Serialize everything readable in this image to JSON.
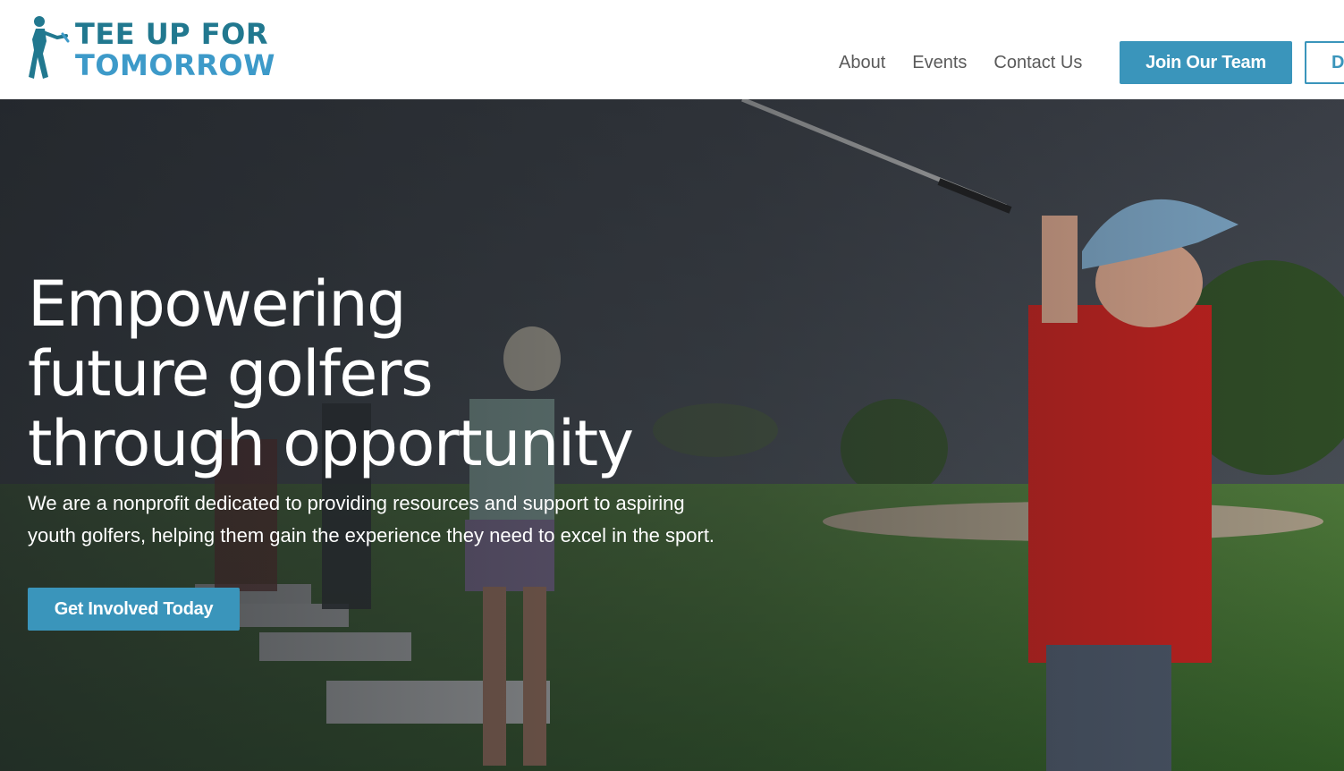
{
  "brand": {
    "line1": "TEE UP FOR",
    "line2": "TOMORROW"
  },
  "nav": {
    "items": [
      {
        "label": "About"
      },
      {
        "label": "Events"
      },
      {
        "label": "Contact Us"
      }
    ],
    "join_label": "Join Our Team",
    "second_button_label": "D"
  },
  "hero": {
    "title_lines": [
      "Empowering",
      "future golfers",
      "through opportunity"
    ],
    "description": "We are a nonprofit dedicated to providing resources and support to aspiring youth golfers, helping them gain the experience they need to excel in the sport.",
    "cta_label": "Get Involved Today"
  },
  "colors": {
    "primary": "#3a95bb",
    "logo_dark": "#21788f",
    "logo_light": "#3d9ac9",
    "nav_text": "#5a5a5a"
  }
}
